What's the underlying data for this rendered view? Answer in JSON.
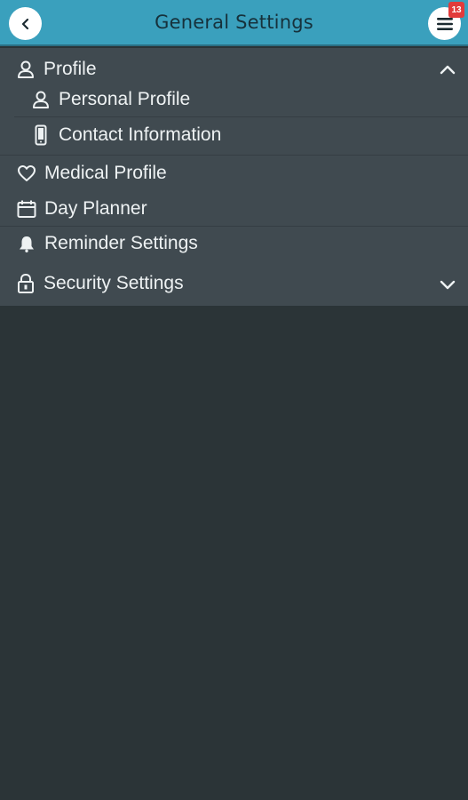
{
  "header": {
    "title": "General Settings",
    "notification_count": "13",
    "back_icon": "chevron-left-icon",
    "menu_icon": "hamburger-menu-icon"
  },
  "menu": {
    "profile": {
      "label": "Profile",
      "icon": "user-icon",
      "expanded": true,
      "children": [
        {
          "label": "Personal Profile",
          "icon": "user-icon"
        },
        {
          "label": "Contact Information",
          "icon": "phone-icon"
        }
      ]
    },
    "medical_profile": {
      "label": "Medical Profile",
      "icon": "heart-icon"
    },
    "day_planner": {
      "label": "Day Planner",
      "icon": "calendar-icon"
    },
    "reminder_settings": {
      "label": "Reminder Settings",
      "icon": "bell-icon"
    },
    "security_settings": {
      "label": "Security Settings",
      "icon": "lock-icon",
      "expanded": false
    }
  },
  "colors": {
    "header_bg": "#3aa0bd",
    "menu_bg": "#404a50",
    "page_bg": "#2b3437",
    "badge": "#e23b3b"
  }
}
